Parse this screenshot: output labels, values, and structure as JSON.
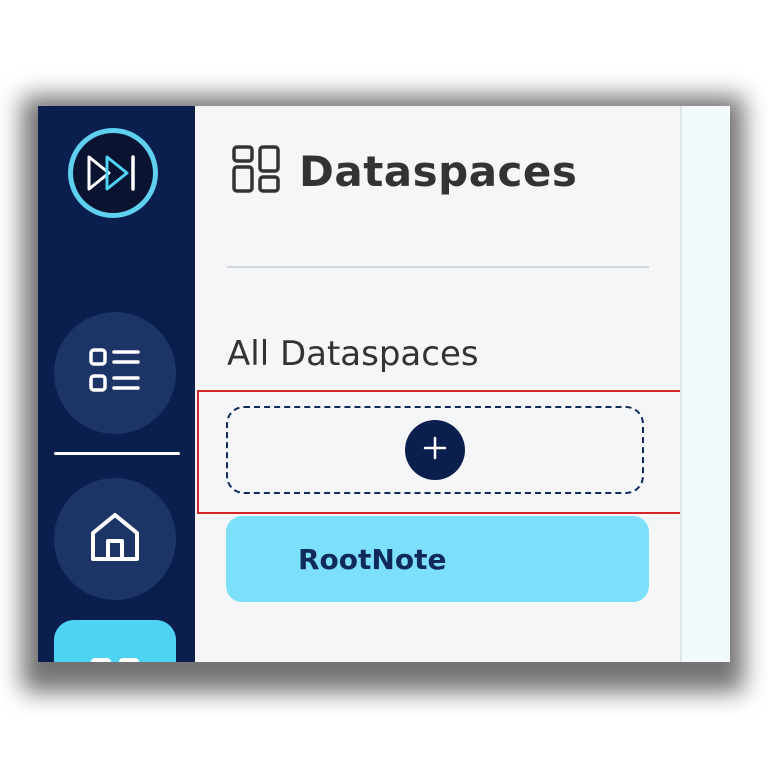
{
  "panel": {
    "title": "Dataspaces",
    "section_label": "All Dataspaces"
  },
  "dataspaces": [
    {
      "label": "RootNote"
    }
  ],
  "colors": {
    "rail": "#0b1f4f",
    "accent": "#4fd3f5",
    "item_bg": "#7de0fb",
    "highlight": "#d6262b"
  },
  "icons": {
    "logo": "fast-forward-logo-icon",
    "rail_list": "list-icon",
    "rail_home": "home-icon",
    "rail_active": "grid-icon",
    "title": "grid-icon",
    "add": "plus-icon"
  }
}
